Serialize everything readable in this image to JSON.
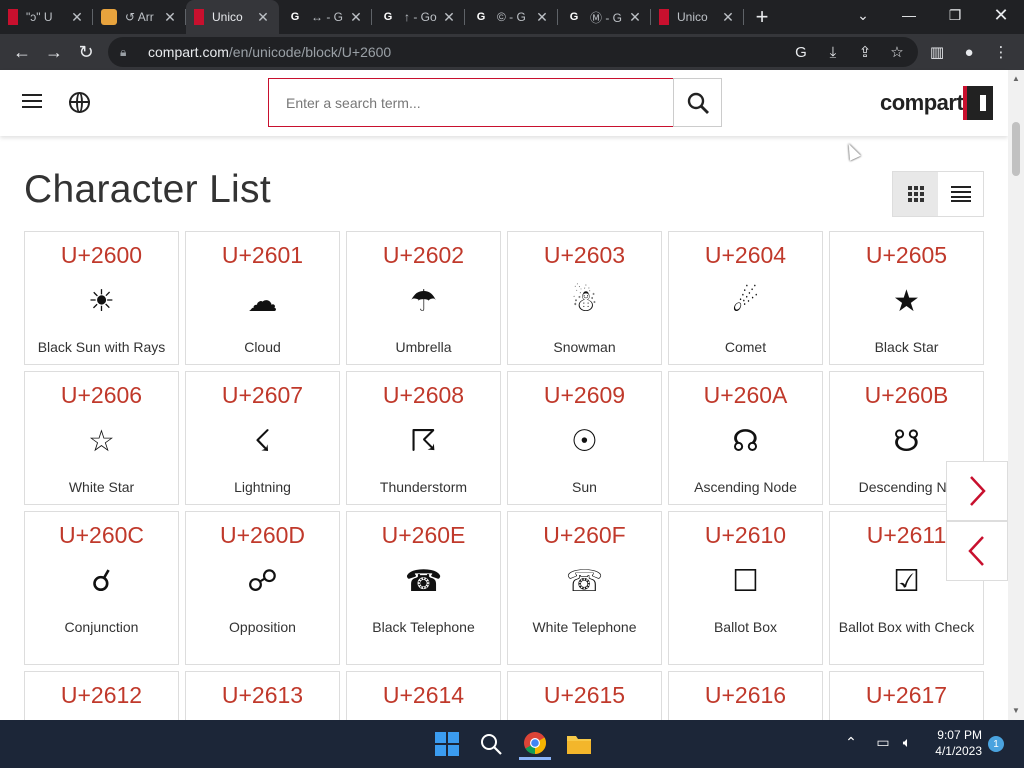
{
  "browser": {
    "tabs": [
      {
        "title": "\"ↄ\" U",
        "favicon": "compart-icon",
        "active": false
      },
      {
        "title": "↺ Arr",
        "favicon": "orange-icon",
        "active": false
      },
      {
        "title": "Unico",
        "favicon": "compart-icon",
        "active": true
      },
      {
        "title": "↔ - G",
        "favicon": "google-icon",
        "active": false
      },
      {
        "title": "↑ - Go",
        "favicon": "google-icon",
        "active": false
      },
      {
        "title": "© - G",
        "favicon": "google-icon",
        "active": false
      },
      {
        "title": "Ⓜ - G",
        "favicon": "google-icon",
        "active": false
      },
      {
        "title": "Unico",
        "favicon": "compart-icon",
        "active": false
      }
    ],
    "new_tab": "+",
    "url_host": "compart.com",
    "url_path": "/en/unicode/block/U+2600"
  },
  "header": {
    "search_placeholder": "Enter a search term..."
  },
  "page": {
    "title": "Character List"
  },
  "characters": [
    {
      "code": "U+2600",
      "glyph": "☀",
      "name": "Black Sun with Rays"
    },
    {
      "code": "U+2601",
      "glyph": "☁",
      "name": "Cloud"
    },
    {
      "code": "U+2602",
      "glyph": "☂",
      "name": "Umbrella"
    },
    {
      "code": "U+2603",
      "glyph": "☃",
      "name": "Snowman"
    },
    {
      "code": "U+2604",
      "glyph": "☄",
      "name": "Comet"
    },
    {
      "code": "U+2605",
      "glyph": "★",
      "name": "Black Star"
    },
    {
      "code": "U+2606",
      "glyph": "☆",
      "name": "White Star"
    },
    {
      "code": "U+2607",
      "glyph": "☇",
      "name": "Lightning"
    },
    {
      "code": "U+2608",
      "glyph": "☈",
      "name": "Thunderstorm"
    },
    {
      "code": "U+2609",
      "glyph": "☉",
      "name": "Sun"
    },
    {
      "code": "U+260A",
      "glyph": "☊",
      "name": "Ascending Node"
    },
    {
      "code": "U+260B",
      "glyph": "☋",
      "name": "Descending No"
    },
    {
      "code": "U+260C",
      "glyph": "☌",
      "name": "Conjunction"
    },
    {
      "code": "U+260D",
      "glyph": "☍",
      "name": "Opposition"
    },
    {
      "code": "U+260E",
      "glyph": "☎",
      "name": "Black Telephone"
    },
    {
      "code": "U+260F",
      "glyph": "☏",
      "name": "White Telephone"
    },
    {
      "code": "U+2610",
      "glyph": "☐",
      "name": "Ballot Box"
    },
    {
      "code": "U+2611",
      "glyph": "☑",
      "name": "Ballot Box with Check"
    },
    {
      "code": "U+2612",
      "glyph": "",
      "name": ""
    },
    {
      "code": "U+2613",
      "glyph": "",
      "name": ""
    },
    {
      "code": "U+2614",
      "glyph": "",
      "name": ""
    },
    {
      "code": "U+2615",
      "glyph": "",
      "name": ""
    },
    {
      "code": "U+2616",
      "glyph": "",
      "name": ""
    },
    {
      "code": "U+2617",
      "glyph": "",
      "name": ""
    }
  ],
  "taskbar": {
    "time": "9:07 PM",
    "date": "4/1/2023",
    "notifications": "1"
  },
  "colors": {
    "accent": "#c8102e",
    "codepoint": "#c0392b",
    "taskbar": "#1c2638"
  }
}
